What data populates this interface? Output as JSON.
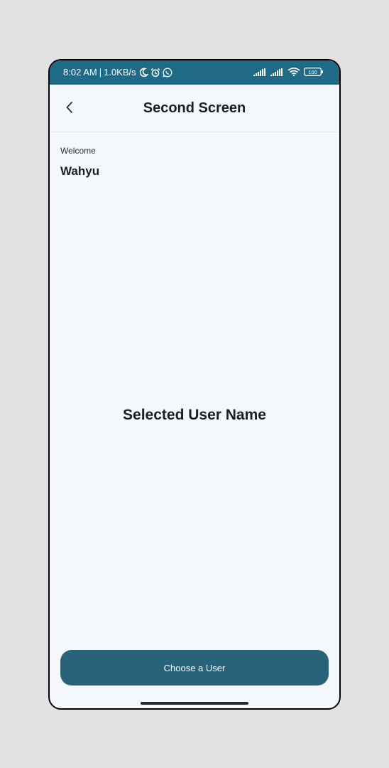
{
  "status_bar": {
    "time": "8:02 AM",
    "separator": "|",
    "speed": "1.0KB/s",
    "battery": "100",
    "icons_left": [
      "moon-icon",
      "alarm-icon",
      "whatsapp-icon"
    ],
    "icons_right": [
      "signal-icon",
      "signal-icon",
      "wifi-icon",
      "battery-icon"
    ]
  },
  "app_bar": {
    "title": "Second Screen",
    "back_icon": "chevron-left-icon"
  },
  "welcome": {
    "label": "Welcome",
    "name": "Wahyu"
  },
  "main": {
    "selected_user": "Selected User Name"
  },
  "footer": {
    "button_label": "Choose a User"
  },
  "colors": {
    "background": "#e2e2e2",
    "status_bar": "#1f6a85",
    "screen": "#f4f7fb",
    "button": "#28637b",
    "text": "#1b1f24"
  }
}
